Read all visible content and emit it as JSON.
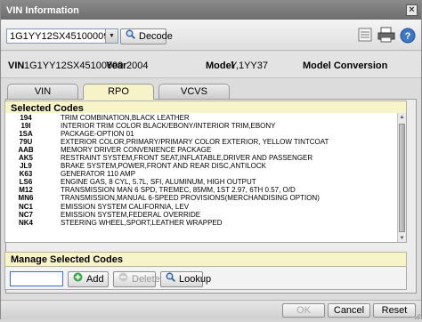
{
  "window": {
    "title": "VIN Information",
    "close_glyph": "×"
  },
  "toolbar": {
    "vin_value": "1G1YY12SX45100009",
    "decode_label": "Decode",
    "icons": [
      "list-icon",
      "printer-icon",
      "help-icon"
    ]
  },
  "vehicle": {
    "vin_label": "VIN",
    "vin_value": "1G1YY12SX45100009",
    "year_label": "Year",
    "year_value": "2004",
    "model_label": "Model",
    "model_value": "Y,1YY37",
    "conversion_label": "Model Conversion"
  },
  "tabs": [
    {
      "label": "VIN",
      "active": false
    },
    {
      "label": "RPO",
      "active": true
    },
    {
      "label": "VCVS",
      "active": false
    }
  ],
  "selected_codes": {
    "heading": "Selected Codes",
    "rows": [
      {
        "code": "194",
        "desc": "TRIM COMBINATION,BLACK LEATHER"
      },
      {
        "code": "19I",
        "desc": "INTERIOR TRIM COLOR BLACK/EBONY/INTERIOR TRIM,EBONY"
      },
      {
        "code": "1SA",
        "desc": "PACKAGE-OPTION 01"
      },
      {
        "code": "79U",
        "desc": "EXTERIOR COLOR,PRIMARY/PRIMARY COLOR EXTERIOR, YELLOW TINTCOAT"
      },
      {
        "code": "AAB",
        "desc": "MEMORY DRIVER CONVENIENCE PACKAGE"
      },
      {
        "code": "AK5",
        "desc": "RESTRAINT SYSTEM,FRONT SEAT,INFLATABLE,DRIVER AND PASSENGER"
      },
      {
        "code": "JL9",
        "desc": "BRAKE SYSTEM,POWER,FRONT AND REAR DISC,ANTILOCK"
      },
      {
        "code": "K63",
        "desc": "GENERATOR 110 AMP"
      },
      {
        "code": "LS6",
        "desc": "ENGINE GAS, 8 CYL, 5.7L, SFI, ALUMINUM, HIGH OUTPUT"
      },
      {
        "code": "M12",
        "desc": "TRANSMISSION MAN 6 SPD, TREMEC, 85MM, 1ST 2.97, 6TH 0.57,   O/D"
      },
      {
        "code": "MN6",
        "desc": "TRANSMISSION,MANUAL 6-SPEED PROVISIONS(MERCHANDISING OPTION)"
      },
      {
        "code": "NC1",
        "desc": "EMISSION SYSTEM CALIFORNIA, LEV"
      },
      {
        "code": "NC7",
        "desc": "EMISSION SYSTEM,FEDERAL OVERRIDE"
      },
      {
        "code": "NK4",
        "desc": "STEERING WHEEL,SPORT,LEATHER WRAPPED"
      },
      {
        "code": "",
        "desc": ""
      },
      {
        "code": "",
        "desc": ""
      }
    ]
  },
  "manage": {
    "heading": "Manage Selected Codes",
    "input_value": "",
    "add_label": "Add",
    "delete_label": "Delete",
    "lookup_label": "Lookup"
  },
  "footer": {
    "ok_label": "OK",
    "cancel_label": "Cancel",
    "reset_label": "Reset"
  },
  "colors": {
    "section_header": "#f7f4c9",
    "title_bar": "#7a7a7a",
    "input_focus": "#3b6fcf"
  }
}
